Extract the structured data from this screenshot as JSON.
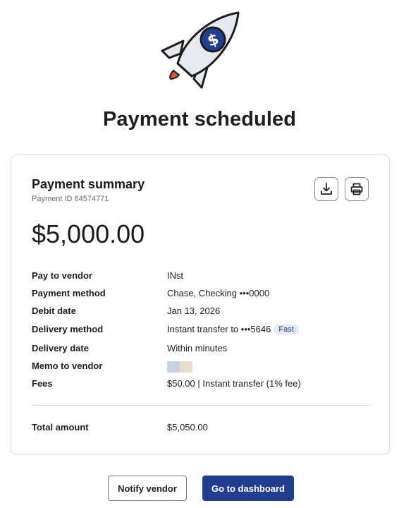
{
  "page": {
    "title": "Payment scheduled"
  },
  "summary": {
    "title": "Payment summary",
    "payment_id_label": "Payment ID",
    "payment_id": "64574771",
    "amount": "$5,000.00"
  },
  "details": [
    {
      "label": "Pay to vendor",
      "value": "INst"
    },
    {
      "label": "Payment method",
      "value": "Chase, Checking •••0000"
    },
    {
      "label": "Debit date",
      "value": "Jan 13, 2026"
    },
    {
      "label": "Delivery method",
      "value": "Instant transfer to •••5646",
      "badge": "Fast"
    },
    {
      "label": "Delivery date",
      "value": "Within minutes"
    },
    {
      "label": "Memo to vendor",
      "value": ""
    },
    {
      "label": "Fees",
      "value": "$50.00 | Instant transfer (1% fee)"
    }
  ],
  "total": {
    "label": "Total amount",
    "value": "$5,050.00"
  },
  "actions": {
    "notify_label": "Notify vendor",
    "dashboard_label": "Go to dashboard"
  },
  "icons": {
    "illustration": "rocket-dollar-icon",
    "download": "download-icon",
    "print": "printer-icon"
  },
  "colors": {
    "primary": "#223f8f",
    "rocket_body": "#e6e9f2",
    "rocket_emblem": "#223f8f",
    "flame": "#d0573a",
    "badge_bg": "#e3e9f7"
  }
}
